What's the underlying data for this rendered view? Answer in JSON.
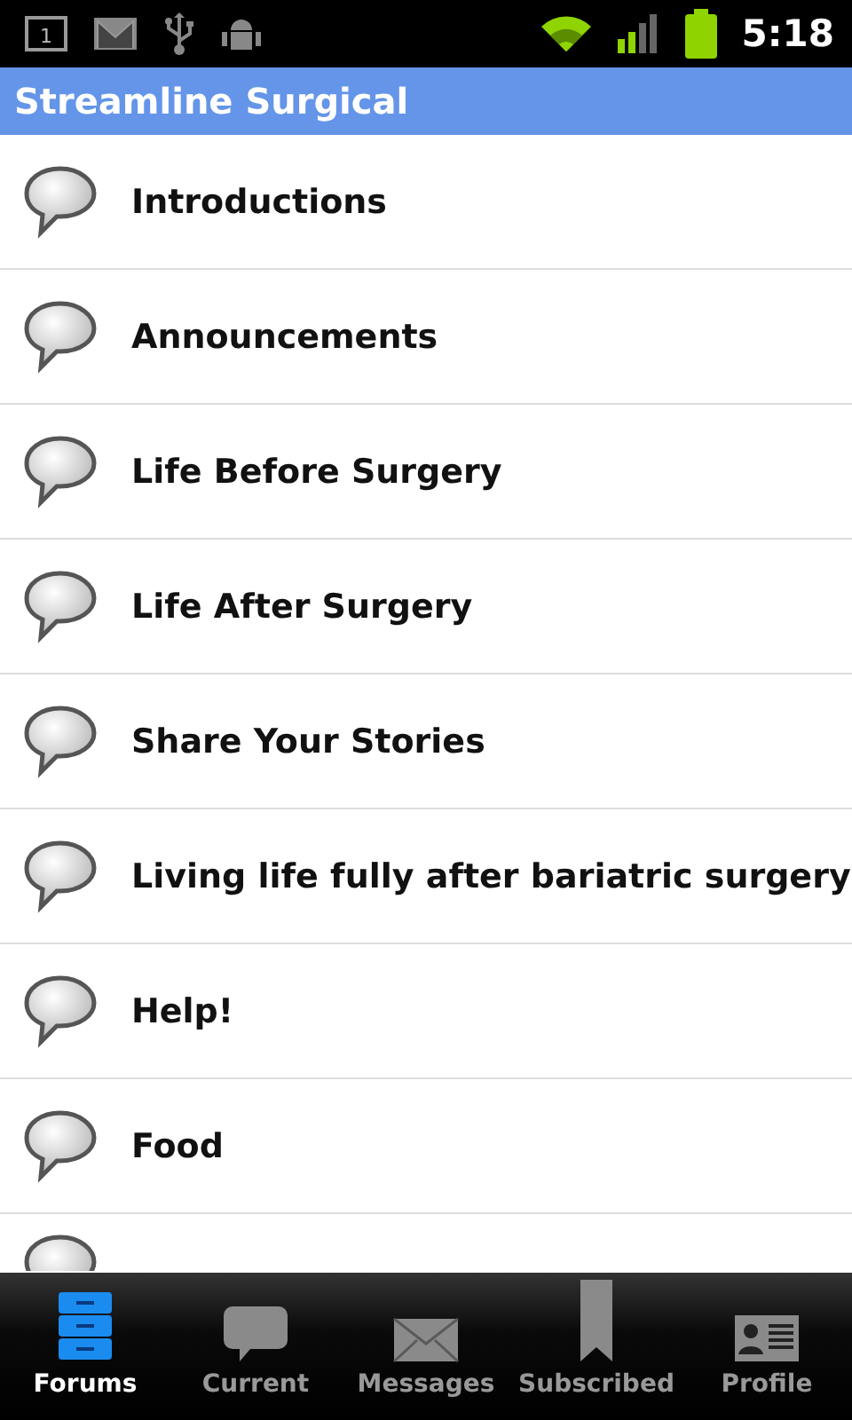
{
  "status_bar": {
    "notification_count": "1",
    "time": "5:18"
  },
  "title": "Streamline Surgical",
  "forums": [
    {
      "name": "Introductions"
    },
    {
      "name": "Announcements"
    },
    {
      "name": "Life Before Surgery"
    },
    {
      "name": "Life After Surgery"
    },
    {
      "name": "Share Your Stories"
    },
    {
      "name": "Living life fully after bariatric surgery"
    },
    {
      "name": "Help!"
    },
    {
      "name": "Food"
    }
  ],
  "tabs": [
    {
      "label": "Forums",
      "kind": "forums",
      "selected": true
    },
    {
      "label": "Current",
      "kind": "current",
      "selected": false
    },
    {
      "label": "Messages",
      "kind": "messages",
      "selected": false
    },
    {
      "label": "Subscribed",
      "kind": "subscribed",
      "selected": false
    },
    {
      "label": "Profile",
      "kind": "profile",
      "selected": false
    }
  ]
}
